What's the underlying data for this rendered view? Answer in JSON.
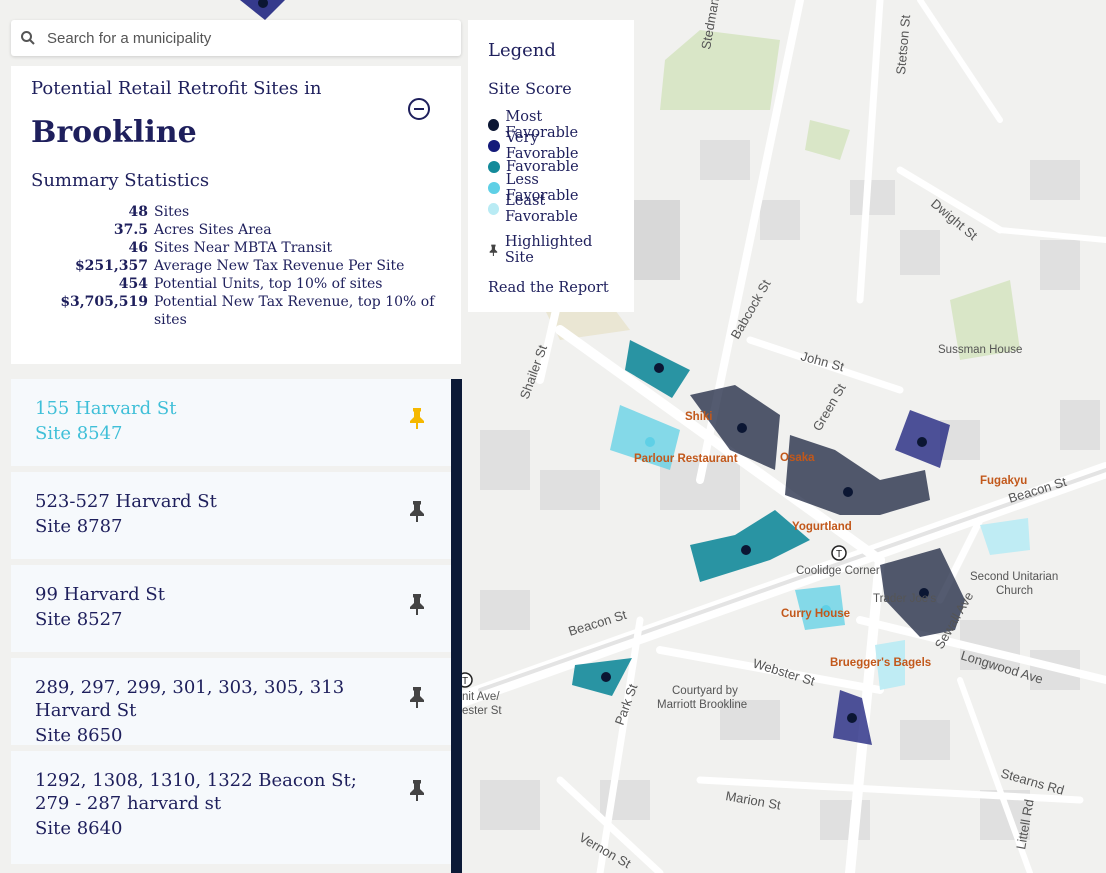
{
  "search": {
    "placeholder": "Search for a municipality"
  },
  "summary": {
    "subtitle": "Potential Retail Retrofit Sites in",
    "town": "Brookline",
    "stats_title": "Summary Statistics",
    "stats": [
      {
        "value": "48",
        "label": "Sites"
      },
      {
        "value": "37.5",
        "label": "Acres Sites Area"
      },
      {
        "value": "46",
        "label": "Sites Near MBTA Transit"
      },
      {
        "value": "$251,357",
        "label": "Average New Tax Revenue Per Site"
      },
      {
        "value": "454",
        "label": "Potential Units, top 10% of sites"
      },
      {
        "value": "$3,705,519",
        "label": "Potential New Tax Revenue, top 10% of sites"
      }
    ]
  },
  "legend": {
    "title": "Legend",
    "subtitle": "Site Score",
    "items": [
      {
        "label": "Most Favorable",
        "color": "#0b1633"
      },
      {
        "label": "Very Favorable",
        "color": "#141a7a"
      },
      {
        "label": "Favorable",
        "color": "#138a9a"
      },
      {
        "label": "Less Favorable",
        "color": "#5fd0e6"
      },
      {
        "label": "Least Favorable",
        "color": "#b9ebf4"
      }
    ],
    "highlighted": "Highlighted Site",
    "read_report": "Read the Report"
  },
  "sites": [
    {
      "address": "155 Harvard St",
      "site": "Site 8547",
      "highlighted": true
    },
    {
      "address": "523-527 Harvard St",
      "site": "Site 8787",
      "highlighted": false
    },
    {
      "address": "99 Harvard St",
      "site": "Site 8527",
      "highlighted": false
    },
    {
      "address": "289, 297, 299, 301, 303, 305, 313 Harvard St",
      "site": "Site 8650",
      "highlighted": false
    },
    {
      "address": "1292, 1308, 1310, 1322 Beacon St; 279 - 287 harvard st",
      "site": "Site 8640",
      "highlighted": false
    }
  ],
  "map": {
    "streets": [
      "Beacon St",
      "Beacon St",
      "Longwood Ave",
      "Webster St",
      "Marion St",
      "Stearns Rd",
      "Sewall Ave",
      "Park St",
      "Babcock St",
      "John St",
      "Green St",
      "Shailer St",
      "Dwight St",
      "Stetson St",
      "Stedman",
      "Vernon St",
      "Littell Rd"
    ],
    "pois": [
      "Shiki",
      "Osaka",
      "Parlour Restaurant",
      "Fugakyu",
      "Yogurtland",
      "Coolidge Corner",
      "Trader Joe's",
      "Curry House",
      "Bruegger's Bagels",
      "Courtyard by",
      "Marriott Brookline",
      "Second Unitarian",
      "Church",
      "Sussman House"
    ],
    "partial_labels": [
      "nit Ave/",
      "ester St"
    ]
  }
}
